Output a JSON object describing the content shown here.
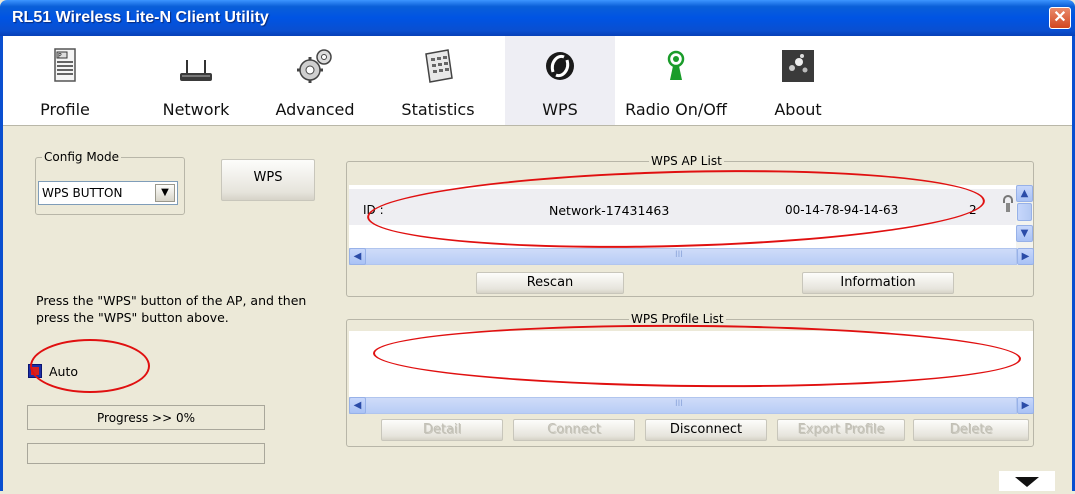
{
  "window": {
    "title": "RL51 Wireless Lite-N Client Utility",
    "close": "✕"
  },
  "toolbar": {
    "items": [
      {
        "label": "Profile",
        "icon": "profile-icon"
      },
      {
        "label": "Network",
        "icon": "network-icon"
      },
      {
        "label": "Advanced",
        "icon": "advanced-icon"
      },
      {
        "label": "Statistics",
        "icon": "statistics-icon"
      },
      {
        "label": "WPS",
        "icon": "wps-icon"
      },
      {
        "label": "Radio On/Off",
        "icon": "radio-icon"
      },
      {
        "label": "About",
        "icon": "about-icon"
      }
    ],
    "active": "WPS"
  },
  "config_mode": {
    "legend": "Config Mode",
    "selected": "WPS BUTTON",
    "wps_button": "WPS"
  },
  "instructions": "Press the \"WPS\" button of the AP, and then press the \"WPS\" button above.",
  "auto": {
    "label": "Auto",
    "checked": true
  },
  "progress": {
    "label": "Progress >> 0%",
    "value": 0
  },
  "ap_list": {
    "legend": "WPS AP List",
    "rows": [
      {
        "id": "ID :",
        "ssid": "Network-17431463",
        "bssid": "00-14-78-94-14-63",
        "channel": "2"
      }
    ],
    "rescan": "Rescan",
    "information": "Information",
    "scroll_mark": "III"
  },
  "profile_list": {
    "legend": "WPS Profile List",
    "scroll_mark": "III",
    "buttons": {
      "detail": "Detail",
      "connect": "Connect",
      "disconnect": "Disconnect",
      "export": "Export Profile",
      "delete": "Delete"
    }
  },
  "colors": {
    "accent": "#0054e3",
    "highlight_ellipse": "#e01010"
  }
}
